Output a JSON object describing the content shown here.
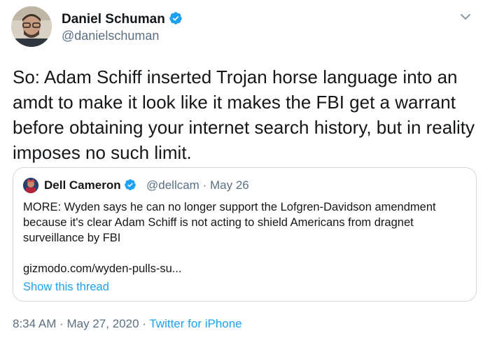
{
  "author": {
    "name": "Daniel Schuman",
    "handle": "@danielschuman",
    "avatar_icon": "profile-photo",
    "verified_icon": "verified-badge-icon"
  },
  "tweet": {
    "text": "So: Adam Schiff inserted Trojan horse language into an amdt to make it look like it makes the FBI get a warrant before obtaining your internet search history, but in reality imposes no such limit."
  },
  "quoted": {
    "name": "Dell Cameron",
    "handle": "@dellcam",
    "separator": "·",
    "date": "May 26",
    "text": "MORE: Wyden says he can no longer support the Lofgren-Davidson amendment because it's clear Adam Schiff is not acting to shield Americans from dragnet surveillance by FBI",
    "link": "gizmodo.com/wyden-pulls-su...",
    "show_thread": "Show this thread"
  },
  "meta": {
    "time": "8:34 AM",
    "separator": "·",
    "date": "May 27, 2020",
    "source": "Twitter for iPhone"
  },
  "colors": {
    "accent": "#1da1f2",
    "secondary_text": "#5b7083",
    "border": "#cfd9de"
  }
}
